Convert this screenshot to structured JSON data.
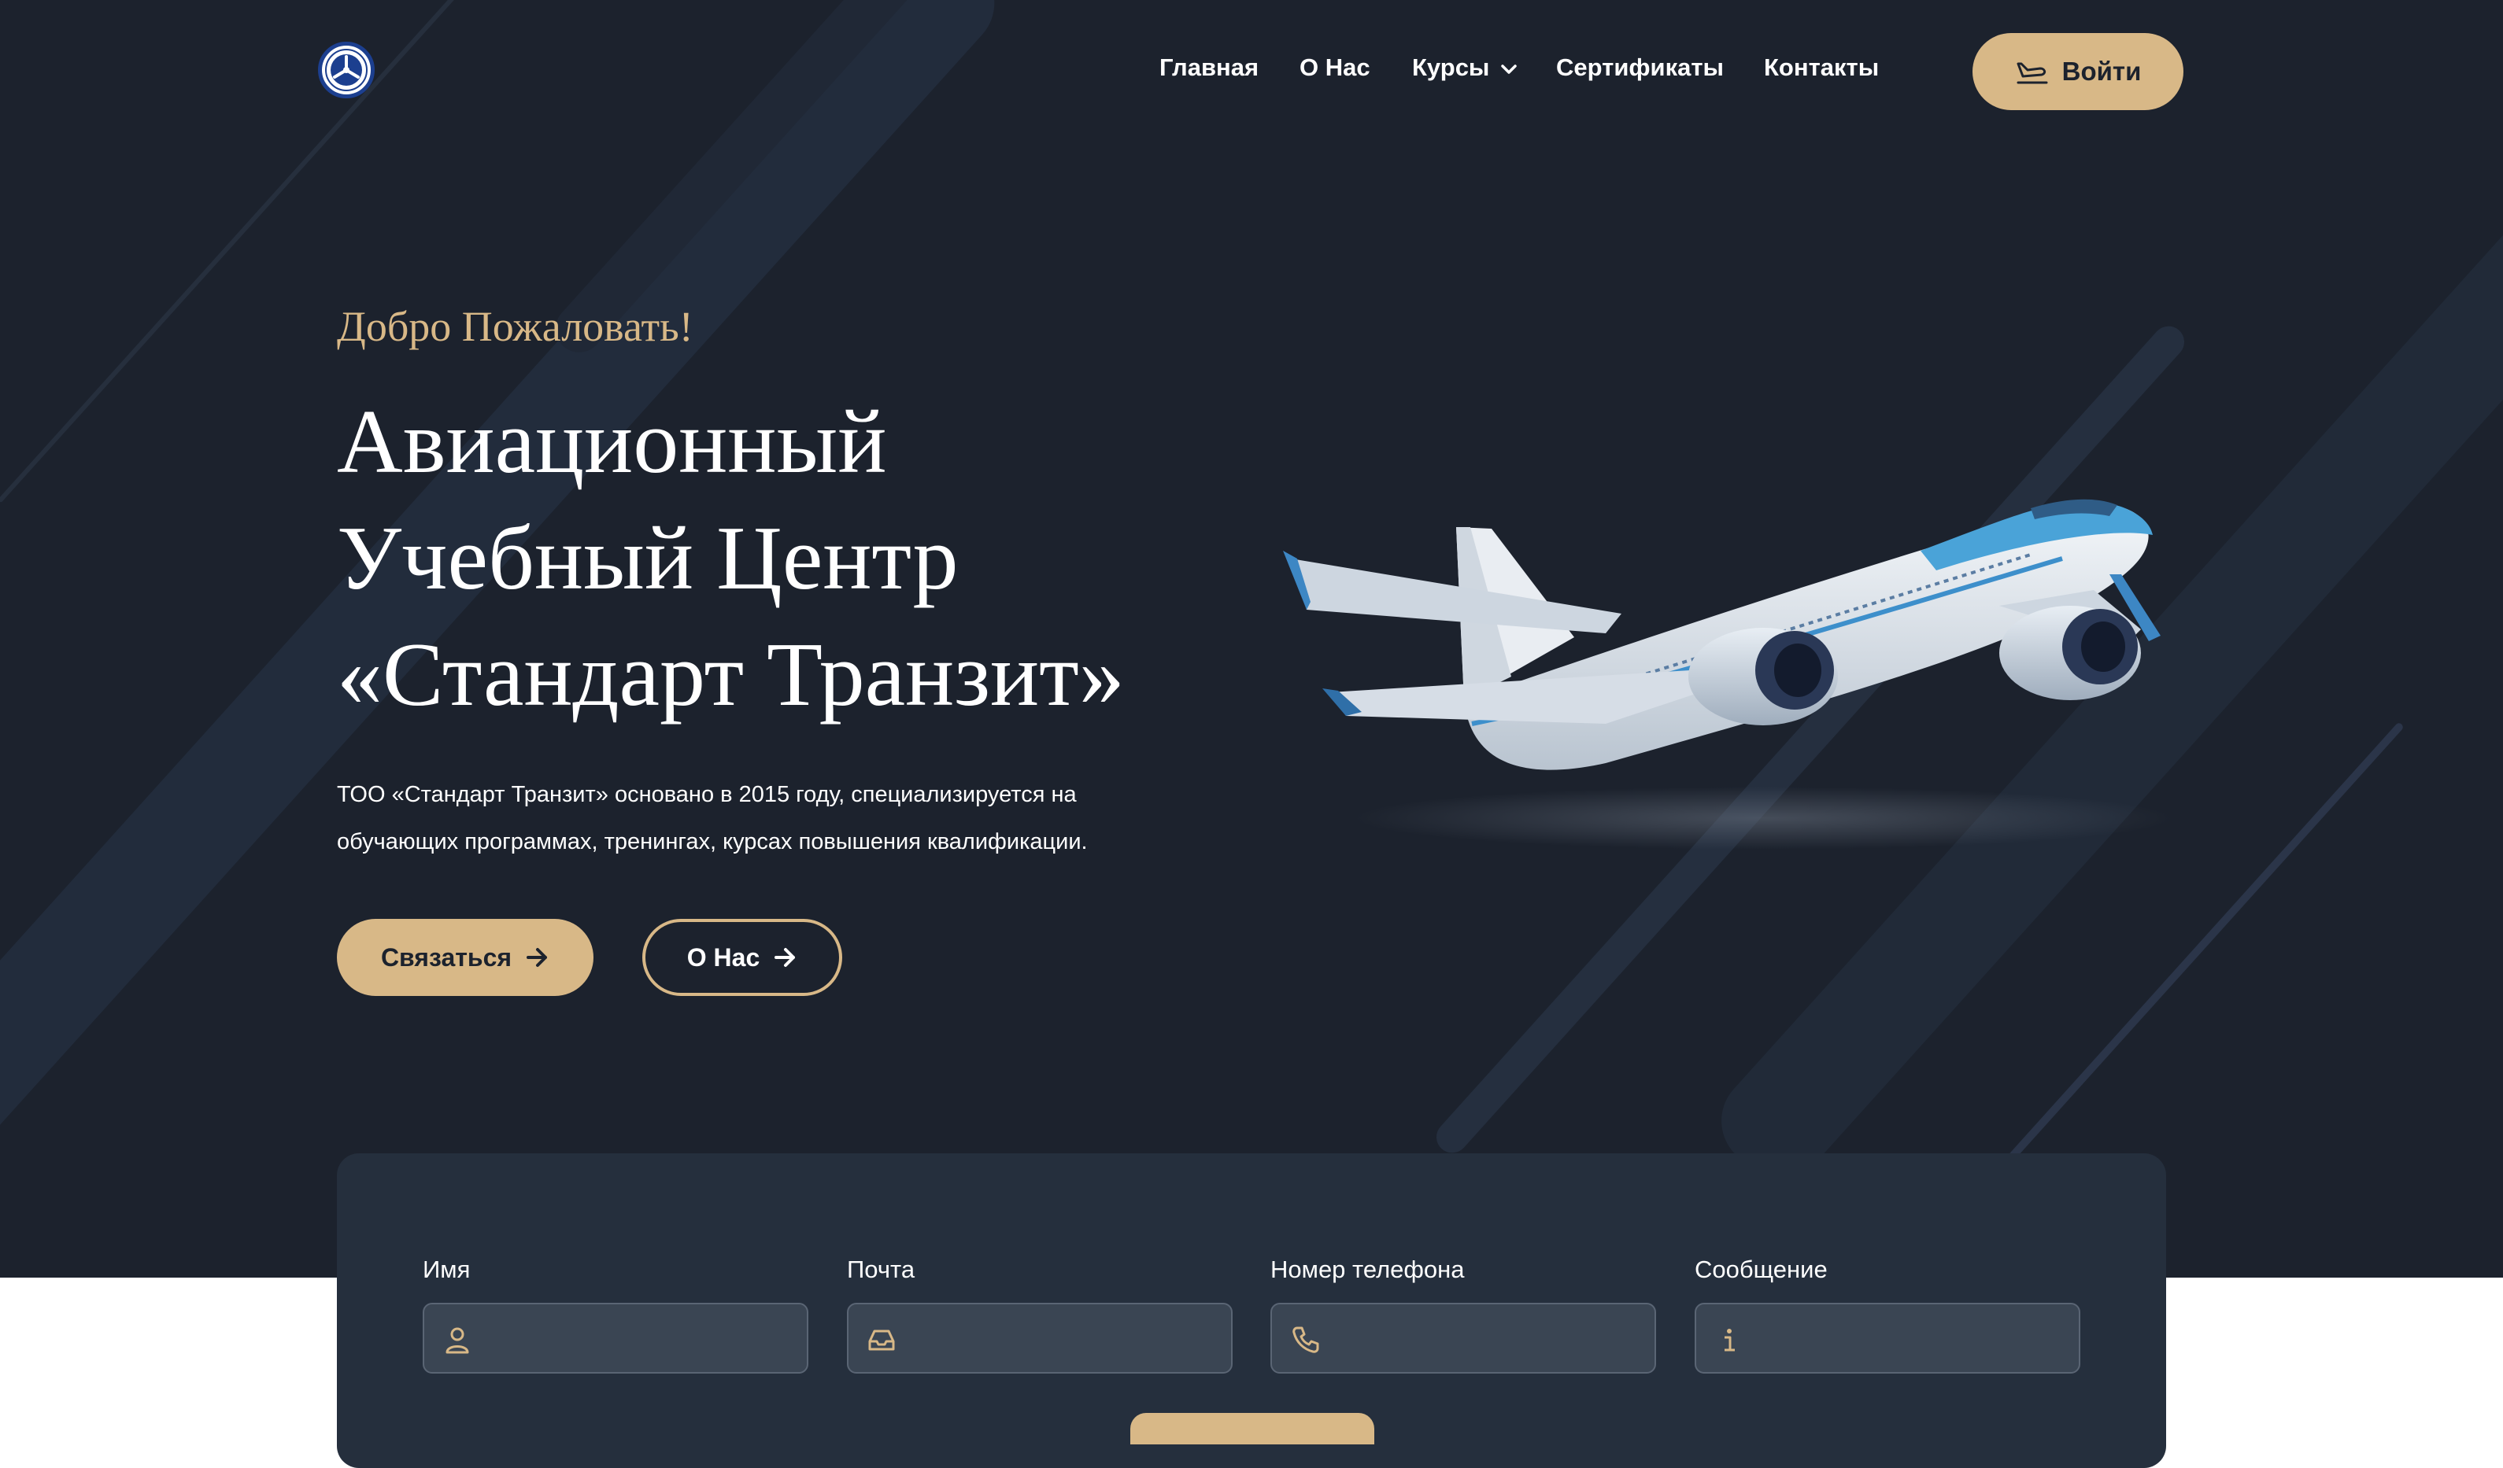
{
  "header": {
    "logo_icon": "propeller-emblem-icon",
    "nav": [
      {
        "label": "Главная"
      },
      {
        "label": "О Нас"
      },
      {
        "label": "Курсы",
        "has_dropdown": true
      },
      {
        "label": "Сертификаты"
      },
      {
        "label": "Контакты"
      }
    ],
    "login_label": "Войти",
    "login_icon": "plane-landing-icon"
  },
  "hero": {
    "welcome": "Добро Пожаловать!",
    "title_lines": [
      "Авиационный",
      "Учебный Центр",
      "«Стандарт Транзит»"
    ],
    "description_lines": [
      "ТОО «Стандарт Транзит» основано в 2015 году, специализируется на",
      "обучающих программах, тренингах, курсах повышения квалификации."
    ],
    "contact_button": "Связаться",
    "about_button": "О Нас",
    "image": "airplane-illustration"
  },
  "form": {
    "fields": [
      {
        "label": "Имя",
        "icon": "user-icon",
        "value": ""
      },
      {
        "label": "Почта",
        "icon": "inbox-icon",
        "value": ""
      },
      {
        "label": "Номер телефона",
        "icon": "phone-icon",
        "value": ""
      },
      {
        "label": "Сообщение",
        "icon": "info-icon",
        "value": ""
      }
    ]
  },
  "colors": {
    "background": "#1c222d",
    "accent": "#d8b887",
    "card": "#252f3d",
    "input": "#3a4553"
  }
}
